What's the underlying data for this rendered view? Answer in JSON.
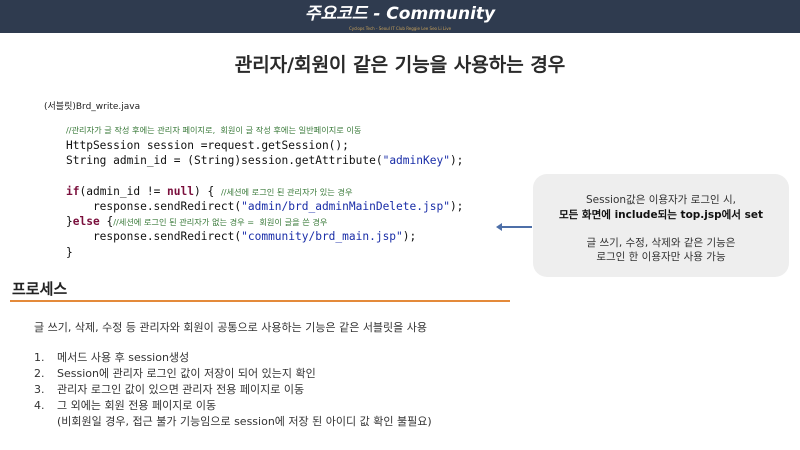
{
  "header": {
    "title": "주요코드 - Community",
    "subtitle": "Cyclops Tech - Seoul IT Club Reggie Lee Seo Li Live"
  },
  "slide": {
    "title": "관리자/회원이 같은 기능을 사용하는 경우",
    "file_label": "(서블릿)Brd_write.java"
  },
  "code": {
    "lines": [
      "//관리자가 글 작성 후에는 관리자 페이지로,  회원이 글 작성 후에는 일반페이지로 이동",
      "HttpSession session =request.getSession();",
      "String admin_id = (String)session.getAttribute(\"adminKey\");",
      "",
      "if(admin_id != null) { //세션에 로그인 된 관리자가 있는 경우",
      "    response.sendRedirect(\"admin/brd_adminMainDelete.jsp\");",
      "}else {//세션에 로그인 된 관리자가 없는 경우 =  회원이 글을 쓴 경우",
      "    response.sendRedirect(\"community/brd_main.jsp\");",
      "}"
    ]
  },
  "callout": {
    "line1": "Session값은 이용자가 로그인 시,",
    "line2": "모든 화면에 include되는 top.jsp에서 set",
    "line3": "글 쓰기, 수정, 삭제와 같은 기능은",
    "line4": "로그인 한 이용자만 사용 가능"
  },
  "process": {
    "title": "프로세스",
    "intro": "글 쓰기, 삭제, 수정 등 관리자와 회원이 공통으로 사용하는 기능은 같은 서블릿을 사용",
    "steps": [
      {
        "num": "1.",
        "text": "메서드 사용 후 session생성"
      },
      {
        "num": "2.",
        "text": "Session에 관리자 로그인 값이 저장이 되어 있는지 확인"
      },
      {
        "num": "3.",
        "text": "관리자 로그인 값이 있으면 관리자 전용 페이지로 이동"
      },
      {
        "num": "4.",
        "text": "그 외에는 회원 전용 페이지로 이동"
      }
    ],
    "note": "(비회원일 경우, 접근 불가 기능임으로 session에 저장 된 아이디 값 확인 불필요)"
  }
}
